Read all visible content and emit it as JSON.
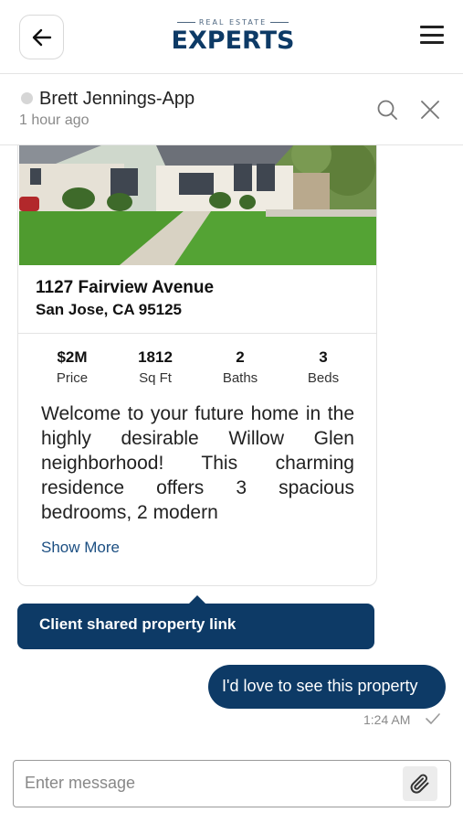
{
  "appbar": {
    "brand_top": "REAL ESTATE",
    "brand_main": "EXPERTS",
    "icons": {
      "back": "arrow-left-icon",
      "menu": "hamburger-menu-icon"
    }
  },
  "chat_header": {
    "contact_name": "Brett Jennings-App",
    "last_seen": "1 hour ago",
    "icons": {
      "search": "search-icon",
      "close": "close-icon"
    }
  },
  "property": {
    "address_line1": "1127 Fairview Avenue",
    "address_line2": "San Jose, CA 95125",
    "stats": [
      {
        "value": "$2M",
        "label": "Price"
      },
      {
        "value": "1812",
        "label": "Sq Ft"
      },
      {
        "value": "2",
        "label": "Baths"
      },
      {
        "value": "3",
        "label": "Beds"
      }
    ],
    "description": "Welcome to your future home in the highly desirable Willow Glen neighborhood! This charming residence offers 3 spacious bedrooms, 2 modern",
    "show_more": "Show More"
  },
  "callout": {
    "text": "Client shared property link"
  },
  "message": {
    "text": "I'd love to see this property",
    "time": "1:24 AM"
  },
  "composer": {
    "placeholder": "Enter message",
    "icons": {
      "attach": "paperclip-icon"
    }
  },
  "colors": {
    "brand_navy": "#0d3a66",
    "link_blue": "#1c4f82",
    "muted": "#8a8a8a"
  }
}
